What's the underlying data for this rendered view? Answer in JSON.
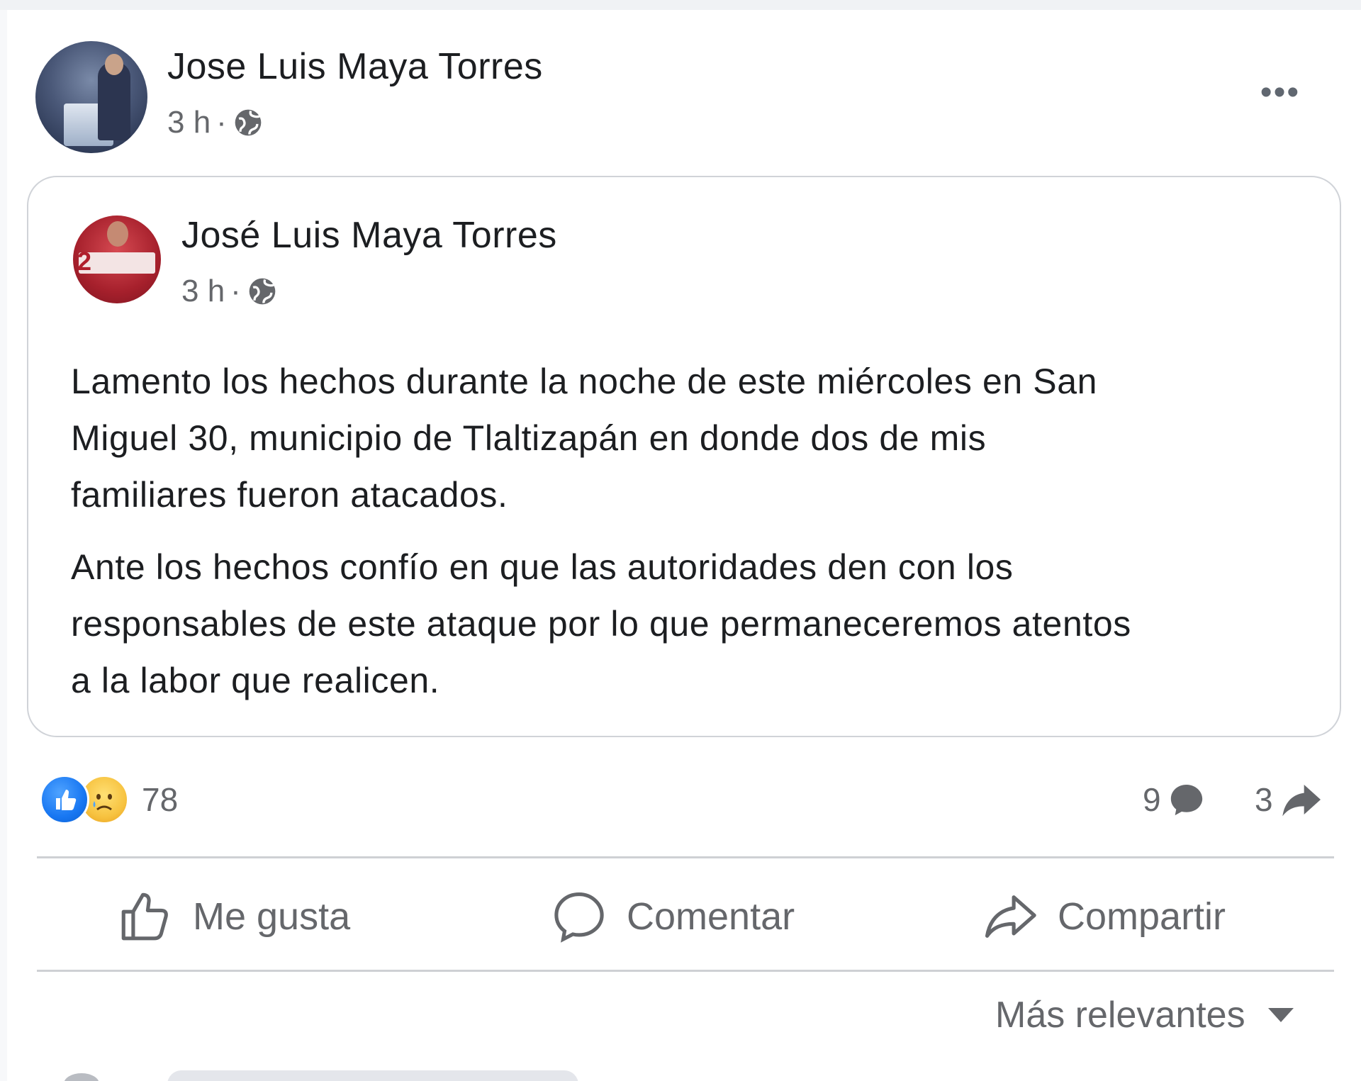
{
  "post": {
    "author": "Jose Luis Maya Torres",
    "time": "3 h",
    "separator": "·",
    "privacy_icon": "globe-icon",
    "more_icon": "more-options-icon",
    "more_label": "•••"
  },
  "shared_post": {
    "author": "José Luis Maya Torres",
    "time": "3 h",
    "separator": "·",
    "privacy_icon": "globe-icon",
    "avatar_number": "2",
    "paragraphs": [
      "Lamento los hechos durante la noche de este miércoles en San\nMiguel 30, municipio de Tlaltizapán en donde dos de mis\nfamiliares fueron atacados.",
      "Ante los hechos confío  en que las autoridades den con los\nresponsables de  este ataque por lo que permaneceremos  atentos\na  la labor que realicen."
    ]
  },
  "stats": {
    "reactions": [
      "like",
      "sad"
    ],
    "reaction_count": "78",
    "comment_count": "9",
    "share_count": "3"
  },
  "actions": {
    "like_label": "Me gusta",
    "comment_label": "Comentar",
    "share_label": "Compartir"
  },
  "sort": {
    "label": "Más relevantes"
  },
  "colors": {
    "text_primary": "#1c1e21",
    "text_secondary": "#65676b",
    "like_blue": "#1877f2",
    "sad_yellow": "#f7c341",
    "divider": "#ced0d4"
  }
}
